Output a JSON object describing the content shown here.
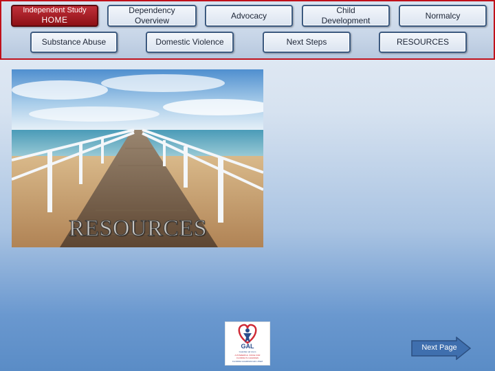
{
  "nav": {
    "home": {
      "top": "Independent Study",
      "main": "HOME"
    },
    "dependency": "Dependency Overview",
    "advocacy": "Advocacy",
    "child_development": "Child Development",
    "normalcy": "Normalcy",
    "substance_abuse": "Substance Abuse",
    "domestic_violence": "Domestic Violence",
    "next_steps": "Next Steps",
    "resources": "RESOURCES"
  },
  "hero": {
    "title": "RESOURCES"
  },
  "logo": {
    "brand": "GAL",
    "line1": "Guardian ad Litem",
    "line2": "A POWERFUL VOICE FOR",
    "line3": "FLORIDA'S CHILDREN",
    "line4": "FLORIDA GUARDIAN AD LITEM"
  },
  "footer": {
    "next_page": "Next Page"
  },
  "colors": {
    "nav_border": "#c0101a",
    "home_button": "#a01820",
    "button_border": "#3c5a80",
    "next_arrow": "#3f6fae"
  }
}
